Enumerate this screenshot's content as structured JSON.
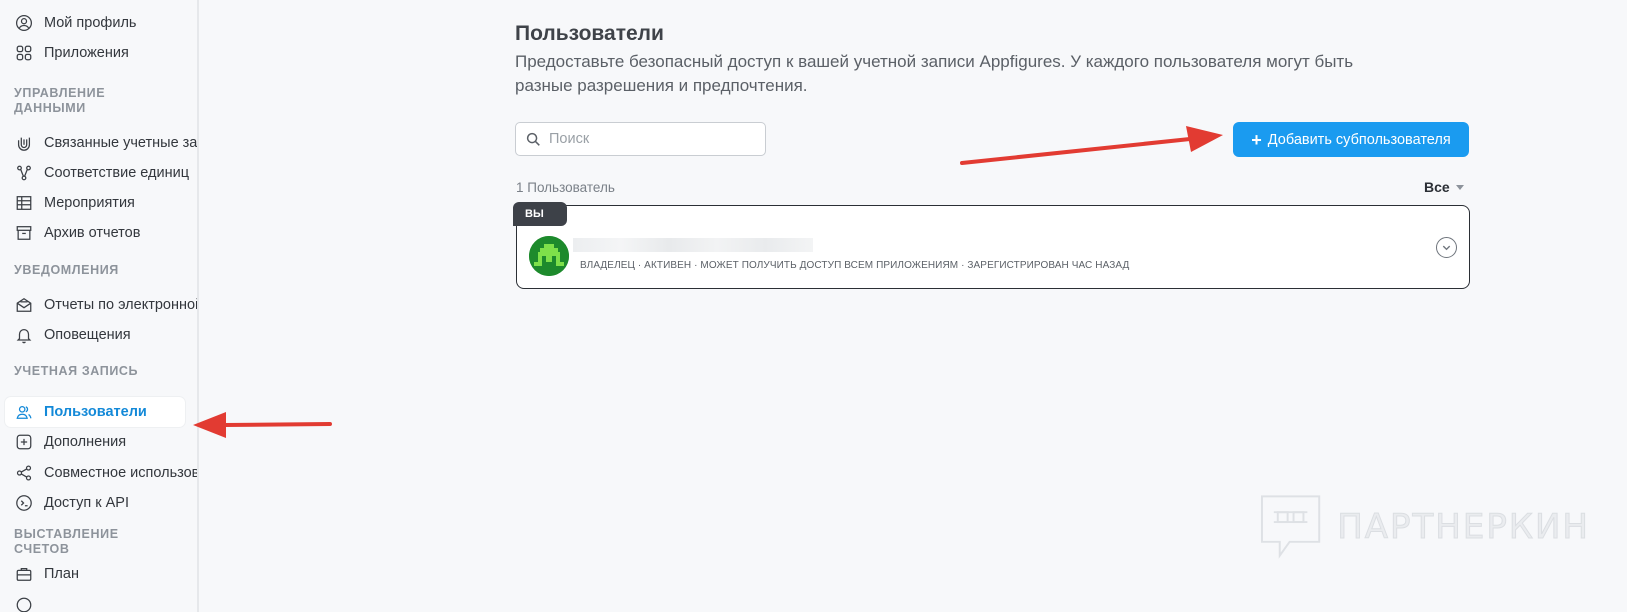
{
  "sidebar": {
    "items": [
      {
        "label": "Мой профиль",
        "icon": "user-circle-icon"
      },
      {
        "label": "Приложения",
        "icon": "apps-grid-icon"
      },
      {
        "label": "Связанные учетные записи",
        "icon": "link-icon"
      },
      {
        "label": "Соответствие единиц",
        "icon": "mapping-icon"
      },
      {
        "label": "Мероприятия",
        "icon": "table-icon"
      },
      {
        "label": "Архив отчетов",
        "icon": "archive-icon"
      },
      {
        "label": "Отчеты по электронной почте",
        "icon": "mail-report-icon"
      },
      {
        "label": "Оповещения",
        "icon": "bell-icon"
      },
      {
        "label": "Пользователи",
        "icon": "users-icon",
        "active": true
      },
      {
        "label": "Дополнения",
        "icon": "plus-square-icon"
      },
      {
        "label": "Совместное использование",
        "icon": "share-icon"
      },
      {
        "label": "Доступ к API",
        "icon": "terminal-icon"
      },
      {
        "label": "План",
        "icon": "briefcase-icon"
      }
    ],
    "sections": {
      "data": "УПРАВЛЕНИЕ ДАННЫМИ",
      "notifications": "УВЕДОМЛЕНИЯ",
      "account": "УЧЕТНАЯ ЗАПИСЬ",
      "billing": "ВЫСТАВЛЕНИЕ СЧЕТОВ"
    }
  },
  "main": {
    "title": "Пользователи",
    "subtitle": "Предоставьте безопасный доступ к вашей учетной записи Appfigures. У каждого пользователя могут быть разные разрешения и предпочтения.",
    "search_placeholder": "Поиск",
    "add_button": "Добавить субпользователя",
    "user_count": "1 Пользователь",
    "filter_label": "Все",
    "users": [
      {
        "tag": "ВЫ",
        "meta": "ВЛАДЕЛЕЦ · АКТИВЕН · МОЖЕТ ПОЛУЧИТЬ ДОСТУП ВСЕМ ПРИЛОЖЕНИЯМ · ЗАРЕГИСТРИРОВАН ЧАС НАЗАД"
      }
    ]
  },
  "watermark": "ПАРТНЕРКИН",
  "colors": {
    "accent": "#1a9bf0",
    "active_nav": "#1389d8",
    "annotation_arrow": "#e23b32",
    "avatar_bg": "#1d8a2c"
  }
}
